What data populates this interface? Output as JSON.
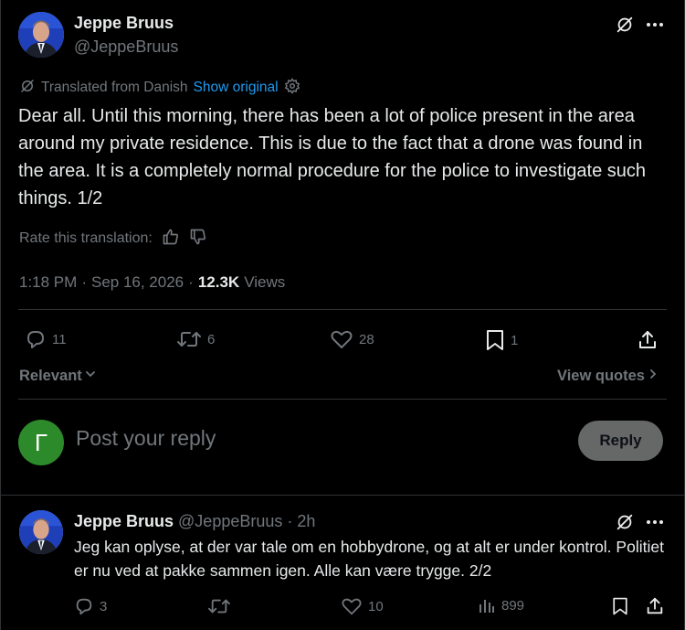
{
  "tweet": {
    "author_name": "Jeppe Bruus",
    "author_handle": "@JeppeBruus",
    "translated_from": "Translated from Danish",
    "show_original": "Show original",
    "text": "Dear all. Until this morning, there has been a lot of police present in the area around my private residence. This is due to the fact that a drone was found in the area. It is a completely normal procedure for the police to investigate such things. 1/2",
    "rate_label": "Rate this translation:",
    "time": "1:18 PM",
    "dot": "·",
    "date": "Sep 16, 2026",
    "views_count": "12.3K",
    "views_label": "Views",
    "replies": "11",
    "reposts": "6",
    "likes": "28",
    "bookmarks": "1"
  },
  "filters": {
    "relevant": "Relevant",
    "view_quotes": "View quotes"
  },
  "composer": {
    "avatar_letter": "Γ",
    "placeholder": "Post your reply",
    "reply_button": "Reply"
  },
  "reply_tweet": {
    "author_name": "Jeppe Bruus",
    "handle_time": "@JeppeBruus · 2h",
    "text": "Jeg kan oplyse, at der var tale om en hobbydrone, og at alt er under kontrol. Politiet er nu ved at pakke sammen igen. Alle kan være trygge. 2/2",
    "replies": "3",
    "reposts": "",
    "likes": "10",
    "views": "899"
  },
  "colors": {
    "background": "#000000",
    "text": "#e7e9ea",
    "muted": "#71767b",
    "link": "#1d9bf0",
    "divider": "#2f3336",
    "composer_avatar": "#2d8a2b"
  },
  "icons": [
    "grok-translate-icon",
    "more-icon",
    "translate-icon",
    "gear-icon",
    "thumbs-up-icon",
    "thumbs-down-icon",
    "reply-icon",
    "repost-icon",
    "like-icon",
    "bookmark-icon",
    "share-icon",
    "chevron-down-icon",
    "chevron-right-icon",
    "views-icon"
  ]
}
